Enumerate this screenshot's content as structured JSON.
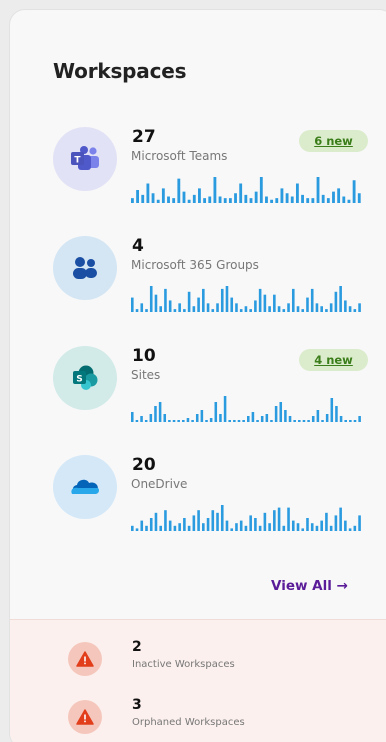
{
  "header": {
    "title": "Workspaces"
  },
  "workspaces": [
    {
      "count": "27",
      "label": "Microsoft Teams",
      "badge": "6 new",
      "spark": [
        3,
        8,
        5,
        12,
        6,
        2,
        9,
        4,
        3,
        15,
        7,
        2,
        5,
        9,
        3,
        4,
        16,
        4,
        3,
        3,
        6,
        12,
        5,
        3,
        7,
        16,
        4,
        2,
        3,
        9,
        6,
        4,
        12,
        5,
        3,
        3,
        16,
        5,
        3,
        7,
        9,
        4,
        2,
        14,
        6
      ]
    },
    {
      "count": "4",
      "label": "Microsoft 365 Groups",
      "badge": "",
      "spark": [
        5,
        1,
        3,
        1,
        9,
        6,
        2,
        8,
        4,
        1,
        3,
        1,
        7,
        2,
        5,
        8,
        3,
        1,
        3,
        8,
        9,
        5,
        3,
        1,
        2,
        1,
        4,
        8,
        6,
        2,
        6,
        2,
        1,
        3,
        8,
        2,
        1,
        5,
        8,
        3,
        2,
        1,
        3,
        7,
        9,
        4,
        2,
        1,
        3
      ]
    },
    {
      "count": "10",
      "label": "Sites",
      "badge": "4 new",
      "spark": [
        5,
        1,
        3,
        1,
        4,
        8,
        10,
        4,
        1,
        1,
        1,
        1,
        2,
        1,
        4,
        6,
        1,
        2,
        10,
        4,
        13,
        1,
        1,
        1,
        1,
        3,
        5,
        1,
        3,
        4,
        1,
        8,
        10,
        6,
        3,
        1,
        1,
        1,
        1,
        3,
        6,
        1,
        4,
        12,
        8,
        3,
        1,
        1,
        1,
        3
      ]
    },
    {
      "count": "20",
      "label": "OneDrive",
      "badge": "",
      "spark": [
        2,
        1,
        4,
        2,
        5,
        7,
        2,
        8,
        4,
        2,
        3,
        5,
        2,
        6,
        8,
        3,
        5,
        8,
        7,
        10,
        4,
        1,
        3,
        4,
        2,
        6,
        5,
        2,
        7,
        3,
        8,
        9,
        2,
        9,
        4,
        3,
        1,
        5,
        3,
        2,
        4,
        7,
        2,
        6,
        9,
        4,
        1,
        2,
        6
      ]
    }
  ],
  "footer": {
    "view_all": "View All →"
  },
  "alerts": [
    {
      "count": "2",
      "label": "Inactive Workspaces"
    },
    {
      "count": "3",
      "label": "Orphaned Workspaces"
    }
  ],
  "colors": {
    "accent": "#5a1c98",
    "spark": "#2b9be0",
    "badge_bg": "#dbeccc",
    "teams_bg": "#e2e2f6",
    "groups_bg": "#d4e6f4",
    "sites_bg": "#d2ebe8",
    "onedrive_bg": "#d4e8f8"
  }
}
